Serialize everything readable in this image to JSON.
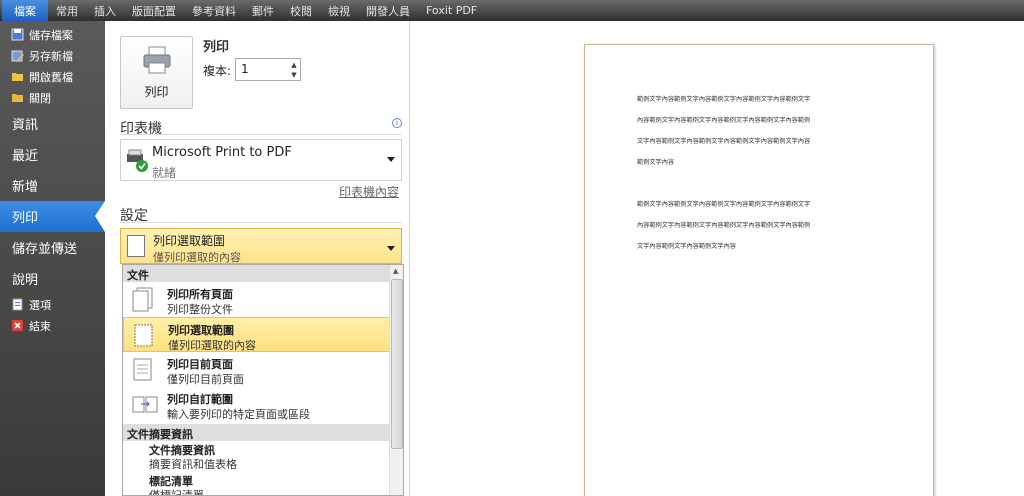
{
  "ribbon": {
    "tabs": [
      "檔案",
      "常用",
      "插入",
      "版面配置",
      "參考資料",
      "郵件",
      "校閱",
      "檢視",
      "開發人員",
      "Foxit PDF"
    ]
  },
  "nav": {
    "commands": [
      {
        "label": "儲存檔案",
        "icon": "save-icon"
      },
      {
        "label": "另存新檔",
        "icon": "save-as-icon"
      },
      {
        "label": "開啟舊檔",
        "icon": "open-folder-icon"
      },
      {
        "label": "關閉",
        "icon": "close-folder-icon"
      }
    ],
    "tabs": [
      "資訊",
      "最近",
      "新增",
      "列印",
      "儲存並傳送",
      "說明"
    ],
    "active_tab": "列印",
    "bottom_commands": [
      {
        "label": "選項",
        "icon": "options-icon"
      },
      {
        "label": "結束",
        "icon": "exit-icon"
      }
    ]
  },
  "print": {
    "section_title": "列印",
    "button_label": "列印",
    "copies_label": "複本:",
    "copies_value": "1"
  },
  "printer": {
    "section_title": "印表機",
    "name": "Microsoft Print to PDF",
    "status": "就緒",
    "properties_link": "印表機內容"
  },
  "settings": {
    "section_title": "設定",
    "selected_title": "列印選取範圍",
    "selected_sub": "僅列印選取的內容"
  },
  "dropdown": {
    "group_document": "文件",
    "options": [
      {
        "title": "列印所有頁面",
        "sub": "列印整份文件"
      },
      {
        "title": "列印選取範圍",
        "sub": "僅列印選取的內容"
      },
      {
        "title": "列印目前頁面",
        "sub": "僅列印目前頁面"
      },
      {
        "title": "列印自訂範圍",
        "sub": "輸入要列印的特定頁面或區段"
      }
    ],
    "group_info": "文件摘要資訊",
    "info_options": [
      {
        "title": "文件摘要資訊",
        "sub": "摘要資訊和值表格"
      },
      {
        "title": "標記清單",
        "sub": "僅標記清單"
      }
    ]
  },
  "preview": {
    "lines": [
      "範例文字內容範例文字內容範例文字內容範例文字內容範例文字",
      "內容範例文字內容範例文字內容範例文字內容範例文字內容範例",
      "文字內容範例文字內容範例文字內容範例文字內容範例文字內容",
      "範例文字內容",
      "範例文字內容範例文字內容範例文字內容範例文字內容範例文字",
      "內容範例文字內容範例文字內容範例文字內容範例文字內容範例",
      "文字內容範例文字內容範例文字內容"
    ]
  },
  "colors": {
    "accent": "#1f6fd0",
    "highlight": "#fde28a",
    "nav_bg": "#4a4a4a"
  }
}
